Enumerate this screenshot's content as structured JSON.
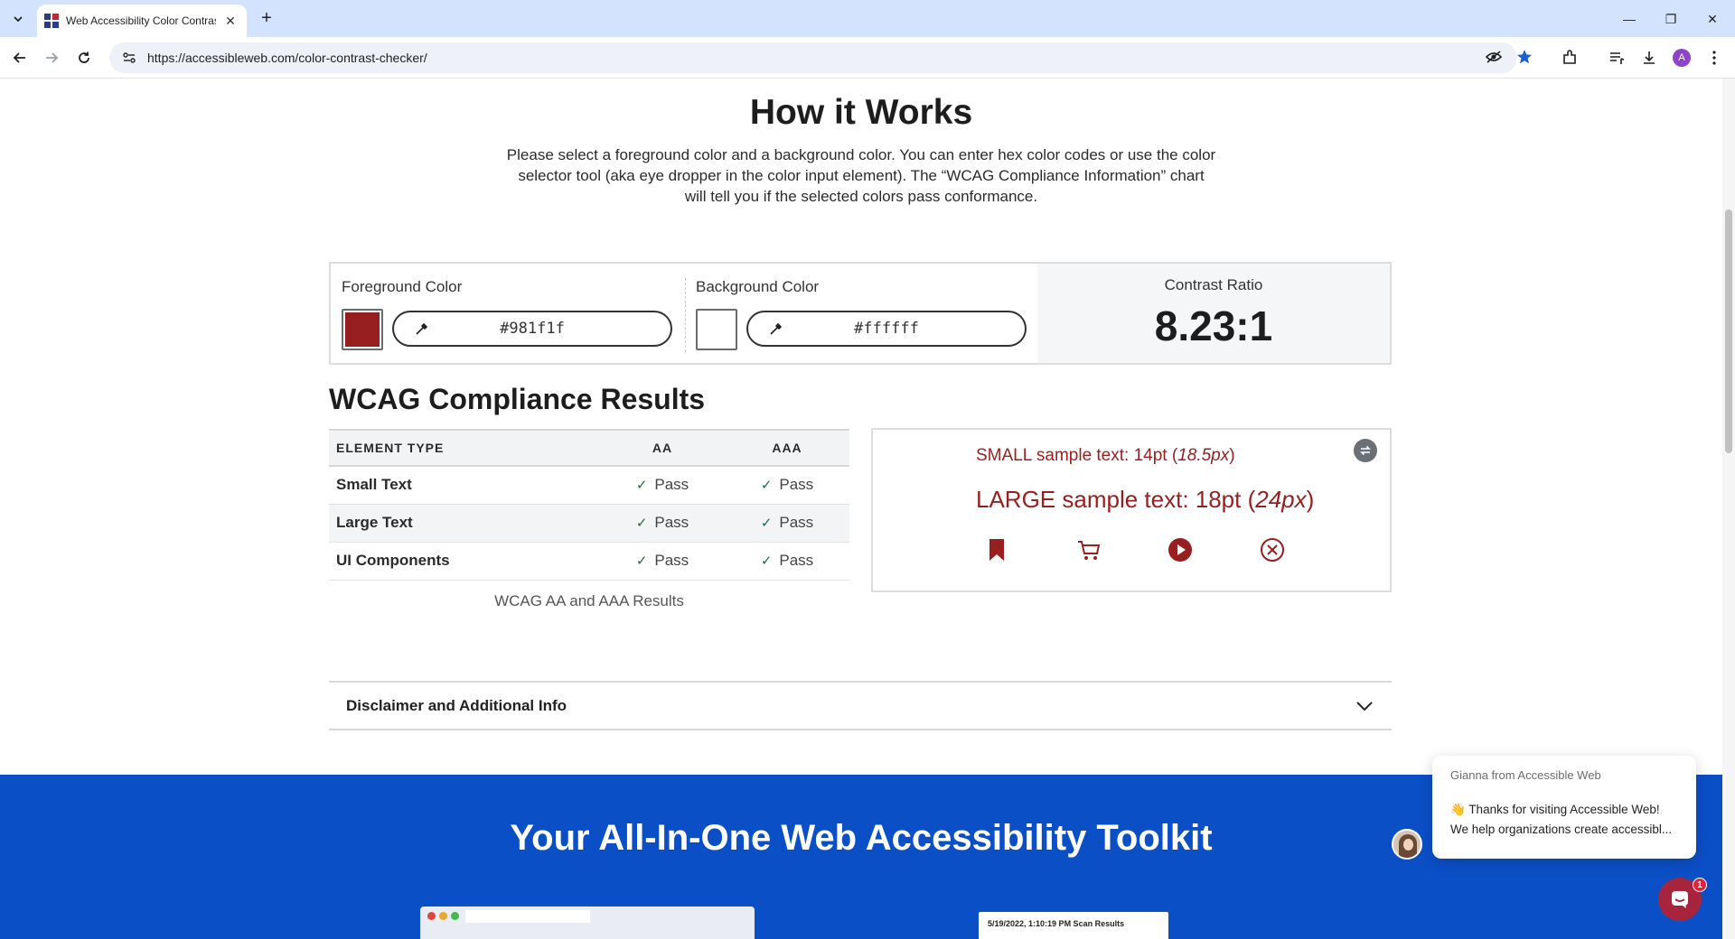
{
  "browser": {
    "tab_title": "Web Accessibility Color Contrast Checker",
    "tab_close": "✕",
    "new_tab": "+",
    "url": "https://accessibleweb.com/color-contrast-checker/",
    "profile_initial": "A",
    "window_controls": {
      "minimize": "—",
      "restore": "❐",
      "close": "✕"
    }
  },
  "how_it_works": {
    "title": "How it Works",
    "description": "Please select a foreground color and a background color. You can enter hex color codes or use the color selector tool (aka eye dropper in the color input element). The “WCAG Compliance Information” chart will tell you if the selected colors pass conformance."
  },
  "picker": {
    "foreground": {
      "label": "Foreground Color",
      "value": "#981f1f",
      "swatch": "#981f1f"
    },
    "background": {
      "label": "Background Color",
      "value": "#ffffff",
      "swatch": "#ffffff"
    },
    "contrast": {
      "label": "Contrast Ratio",
      "value": "8.23:1"
    }
  },
  "wcag": {
    "title": "WCAG Compliance Results",
    "headers": {
      "element_type": "ELEMENT TYPE",
      "aa": "AA",
      "aaa": "AAA"
    },
    "rows": [
      {
        "type": "Small Text",
        "aa": "Pass",
        "aaa": "Pass"
      },
      {
        "type": "Large Text",
        "aa": "Pass",
        "aaa": "Pass"
      },
      {
        "type": "UI Components",
        "aa": "Pass",
        "aaa": "Pass"
      }
    ],
    "caption": "WCAG AA and AAA Results"
  },
  "sample": {
    "small_text": "SMALL sample text: 14pt (",
    "small_px": "18.5px",
    "close_paren": ")",
    "large_text": "LARGE sample text: 18pt (",
    "large_px": "24px",
    "text_color": "#981f1f",
    "icons": [
      "bookmark-icon",
      "cart-icon",
      "play-icon",
      "close-circle-icon"
    ]
  },
  "disclaimer": {
    "label": "Disclaimer and Additional Info"
  },
  "toolkit": {
    "heading": "Your All-In-One Web Accessibility Toolkit",
    "scan_results": "5/19/2022, 1:10:19 PM Scan Results"
  },
  "chat": {
    "from": "Gianna from Accessible Web",
    "message": "👋 Thanks for visiting Accessible Web! We help organizations create accessibl...",
    "badge": "1"
  },
  "colors": {
    "accent": "#0b4fc7",
    "brand_red": "#981f1f",
    "chat": "#a6253c"
  }
}
